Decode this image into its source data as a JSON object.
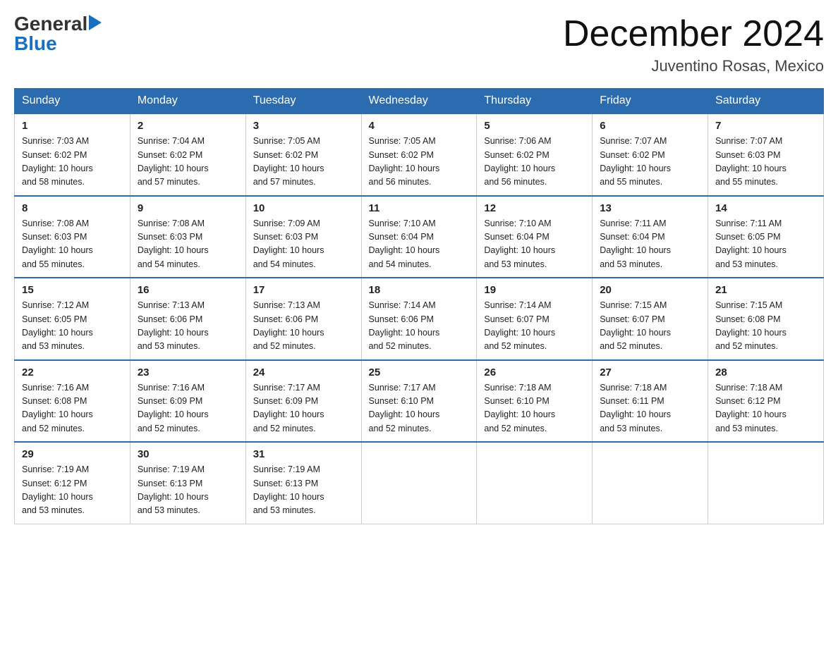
{
  "logo": {
    "general": "General",
    "blue": "Blue",
    "triangle": "▶"
  },
  "title": "December 2024",
  "subtitle": "Juventino Rosas, Mexico",
  "days_of_week": [
    "Sunday",
    "Monday",
    "Tuesday",
    "Wednesday",
    "Thursday",
    "Friday",
    "Saturday"
  ],
  "weeks": [
    [
      {
        "day": "1",
        "sunrise": "7:03 AM",
        "sunset": "6:02 PM",
        "daylight": "10 hours and 58 minutes."
      },
      {
        "day": "2",
        "sunrise": "7:04 AM",
        "sunset": "6:02 PM",
        "daylight": "10 hours and 57 minutes."
      },
      {
        "day": "3",
        "sunrise": "7:05 AM",
        "sunset": "6:02 PM",
        "daylight": "10 hours and 57 minutes."
      },
      {
        "day": "4",
        "sunrise": "7:05 AM",
        "sunset": "6:02 PM",
        "daylight": "10 hours and 56 minutes."
      },
      {
        "day": "5",
        "sunrise": "7:06 AM",
        "sunset": "6:02 PM",
        "daylight": "10 hours and 56 minutes."
      },
      {
        "day": "6",
        "sunrise": "7:07 AM",
        "sunset": "6:02 PM",
        "daylight": "10 hours and 55 minutes."
      },
      {
        "day": "7",
        "sunrise": "7:07 AM",
        "sunset": "6:03 PM",
        "daylight": "10 hours and 55 minutes."
      }
    ],
    [
      {
        "day": "8",
        "sunrise": "7:08 AM",
        "sunset": "6:03 PM",
        "daylight": "10 hours and 55 minutes."
      },
      {
        "day": "9",
        "sunrise": "7:08 AM",
        "sunset": "6:03 PM",
        "daylight": "10 hours and 54 minutes."
      },
      {
        "day": "10",
        "sunrise": "7:09 AM",
        "sunset": "6:03 PM",
        "daylight": "10 hours and 54 minutes."
      },
      {
        "day": "11",
        "sunrise": "7:10 AM",
        "sunset": "6:04 PM",
        "daylight": "10 hours and 54 minutes."
      },
      {
        "day": "12",
        "sunrise": "7:10 AM",
        "sunset": "6:04 PM",
        "daylight": "10 hours and 53 minutes."
      },
      {
        "day": "13",
        "sunrise": "7:11 AM",
        "sunset": "6:04 PM",
        "daylight": "10 hours and 53 minutes."
      },
      {
        "day": "14",
        "sunrise": "7:11 AM",
        "sunset": "6:05 PM",
        "daylight": "10 hours and 53 minutes."
      }
    ],
    [
      {
        "day": "15",
        "sunrise": "7:12 AM",
        "sunset": "6:05 PM",
        "daylight": "10 hours and 53 minutes."
      },
      {
        "day": "16",
        "sunrise": "7:13 AM",
        "sunset": "6:06 PM",
        "daylight": "10 hours and 53 minutes."
      },
      {
        "day": "17",
        "sunrise": "7:13 AM",
        "sunset": "6:06 PM",
        "daylight": "10 hours and 52 minutes."
      },
      {
        "day": "18",
        "sunrise": "7:14 AM",
        "sunset": "6:06 PM",
        "daylight": "10 hours and 52 minutes."
      },
      {
        "day": "19",
        "sunrise": "7:14 AM",
        "sunset": "6:07 PM",
        "daylight": "10 hours and 52 minutes."
      },
      {
        "day": "20",
        "sunrise": "7:15 AM",
        "sunset": "6:07 PM",
        "daylight": "10 hours and 52 minutes."
      },
      {
        "day": "21",
        "sunrise": "7:15 AM",
        "sunset": "6:08 PM",
        "daylight": "10 hours and 52 minutes."
      }
    ],
    [
      {
        "day": "22",
        "sunrise": "7:16 AM",
        "sunset": "6:08 PM",
        "daylight": "10 hours and 52 minutes."
      },
      {
        "day": "23",
        "sunrise": "7:16 AM",
        "sunset": "6:09 PM",
        "daylight": "10 hours and 52 minutes."
      },
      {
        "day": "24",
        "sunrise": "7:17 AM",
        "sunset": "6:09 PM",
        "daylight": "10 hours and 52 minutes."
      },
      {
        "day": "25",
        "sunrise": "7:17 AM",
        "sunset": "6:10 PM",
        "daylight": "10 hours and 52 minutes."
      },
      {
        "day": "26",
        "sunrise": "7:18 AM",
        "sunset": "6:10 PM",
        "daylight": "10 hours and 52 minutes."
      },
      {
        "day": "27",
        "sunrise": "7:18 AM",
        "sunset": "6:11 PM",
        "daylight": "10 hours and 53 minutes."
      },
      {
        "day": "28",
        "sunrise": "7:18 AM",
        "sunset": "6:12 PM",
        "daylight": "10 hours and 53 minutes."
      }
    ],
    [
      {
        "day": "29",
        "sunrise": "7:19 AM",
        "sunset": "6:12 PM",
        "daylight": "10 hours and 53 minutes."
      },
      {
        "day": "30",
        "sunrise": "7:19 AM",
        "sunset": "6:13 PM",
        "daylight": "10 hours and 53 minutes."
      },
      {
        "day": "31",
        "sunrise": "7:19 AM",
        "sunset": "6:13 PM",
        "daylight": "10 hours and 53 minutes."
      },
      null,
      null,
      null,
      null
    ]
  ],
  "labels": {
    "sunrise": "Sunrise:",
    "sunset": "Sunset:",
    "daylight": "Daylight:"
  }
}
